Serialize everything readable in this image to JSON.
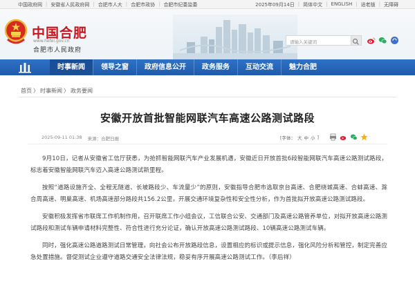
{
  "topbar": {
    "links": [
      "中国政府网",
      "安徽省人民政府网",
      "合肥市人大",
      "合肥市政协",
      "合肥市纪委监委"
    ],
    "date": "2025年09月14日",
    "right_links": [
      "简体中文",
      "ENGLISH",
      "适老版",
      "无障碍"
    ]
  },
  "header": {
    "logo_text": "中国合肥",
    "logo_url": "www.hefei.gov.cn",
    "logo_sub": "合肥市人民政府",
    "search_placeholder": "请输入关键词"
  },
  "nav": {
    "items": [
      "时事新闻",
      "领导之窗",
      "政府信息公开",
      "政务服务",
      "互动交流",
      "魅力合肥"
    ],
    "active_index": 0
  },
  "breadcrumb": [
    "首页",
    "时事新闻",
    "政务要闻"
  ],
  "breadcrumb_sep": " 〉",
  "article": {
    "title": "安徽开放首批智能网联汽车高速公路测试路段",
    "datetime": "2025-09-11 01:38",
    "source": "来源：合肥日报",
    "font_label": "[字体：",
    "font_sizes": [
      "大",
      "中",
      "小"
    ],
    "font_end": "]",
    "paragraphs": [
      "9月10日，记者从安徽省工信厅获悉，为抢抓智能网联汽车产业发展机遇，安徽近日开放首批6段智能网联汽车高速公路测试路段，标志着安徽智能网联汽车迈入高速公路测试新里程。",
      "按照“道路设施齐全、全程无隧道、长坡路段少、车流量少”的原则，安徽指导合肥市选取京台高速、合肥绕城高速、合蚌高速、滁合周高速、明巢高速、机场高速部分路段共156.2公里，开展交通环境复杂性和安全性分析，作为首批拟开放高速公路测试路段。",
      "安徽积极发挥省市联席工作机制作用，召开联席工作小组会议，工信联合公安、交通部门及高速公路管养单位，对拟开放高速公路测试路段和测试车辆申请材料完整性、符合性进行充分论证，确认开放高速公路测试路段、10辆高速公路测试车辆。",
      "同时，强化高速公路道路测试日常管理，向社会公布开放路段信息，设置相应的标识或提示信息，强化风险分析和管控，制定完善应急处置措施。督促测试企业遵守道路交通安全法律法规，稳妥有序开展高速公路测试工作。（李后祥）"
    ]
  },
  "colors": {
    "brand_red": "#c8151d",
    "nav_blue": "#2467bb",
    "nav_active": "#1a4f98"
  }
}
